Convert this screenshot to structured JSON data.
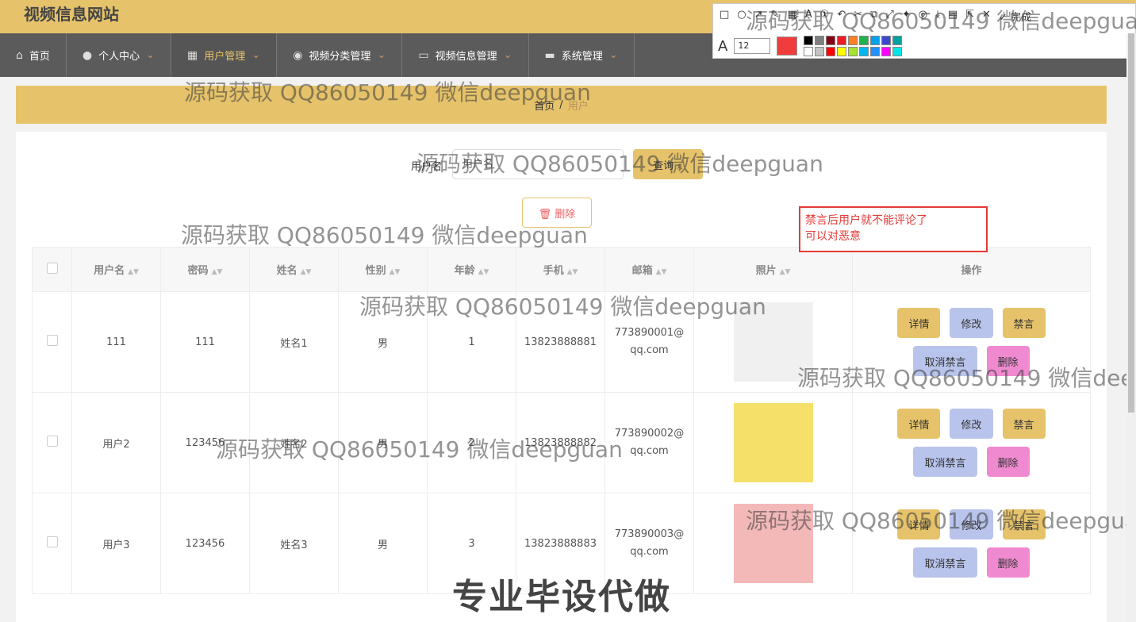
{
  "site_title": "视频信息网站",
  "nav": [
    {
      "icon": "home-icon",
      "glyph": "⌂",
      "label": "首页",
      "active": false,
      "caret": false
    },
    {
      "icon": "user-icon",
      "glyph": "●",
      "label": "个人中心",
      "active": false,
      "caret": true
    },
    {
      "icon": "grid-icon",
      "glyph": "▦",
      "label": "用户管理",
      "active": true,
      "caret": true
    },
    {
      "icon": "bulb-icon",
      "glyph": "◉",
      "label": "视频分类管理",
      "active": false,
      "caret": true
    },
    {
      "icon": "chat-icon",
      "glyph": "▭",
      "label": "视频信息管理",
      "active": false,
      "caret": true
    },
    {
      "icon": "briefcase-icon",
      "glyph": "▬",
      "label": "系统管理",
      "active": false,
      "caret": true
    }
  ],
  "breadcrumb": {
    "home": "首页",
    "sep": "/",
    "current": "用户"
  },
  "search": {
    "label": "用户名",
    "placeholder": "用户名",
    "button": "查询 ⌕"
  },
  "bulk_delete": "🗑 删除",
  "annotation": {
    "line1": "禁言后用户就不能评论了",
    "line2": "可以对恶意"
  },
  "table": {
    "headers": [
      "用户名",
      "密码",
      "姓名",
      "性别",
      "年龄",
      "手机",
      "邮箱",
      "照片",
      "操作"
    ],
    "rows": [
      {
        "username": "111",
        "password": "111",
        "name": "姓名1",
        "gender": "男",
        "age": "1",
        "phone": "13823888881",
        "email": "773890001@qq.com"
      },
      {
        "username": "用户2",
        "password": "123456",
        "name": "姓名2",
        "gender": "男",
        "age": "2",
        "phone": "13823888882",
        "email": "773890002@qq.com"
      },
      {
        "username": "用户3",
        "password": "123456",
        "name": "姓名3",
        "gender": "男",
        "age": "3",
        "phone": "13823888883",
        "email": "773890003@qq.com"
      }
    ],
    "actions": {
      "detail": "详情",
      "edit": "修改",
      "ban": "禁言",
      "unban": "取消禁言",
      "remove": "删除"
    }
  },
  "watermark": "源码获取 QQ86050149 微信deepguan",
  "watermark_big": "专业毕设代做",
  "drawing_toolbar": {
    "font_size": "12",
    "done": "✓ 完成",
    "current_color": "#f03c3c"
  },
  "palette": [
    "#000000",
    "#7f7f7f",
    "#880015",
    "#ed1c24",
    "#ff7f27",
    "#22b14c",
    "#00a2e8",
    "#3f48cc",
    "#00a0a0",
    "#ffffff",
    "#c3c3c3",
    "#ff0000",
    "#ffff00",
    "#a6e22e",
    "#00b7ef",
    "#1e90ff",
    "#ff00ff",
    "#00e5e5"
  ]
}
